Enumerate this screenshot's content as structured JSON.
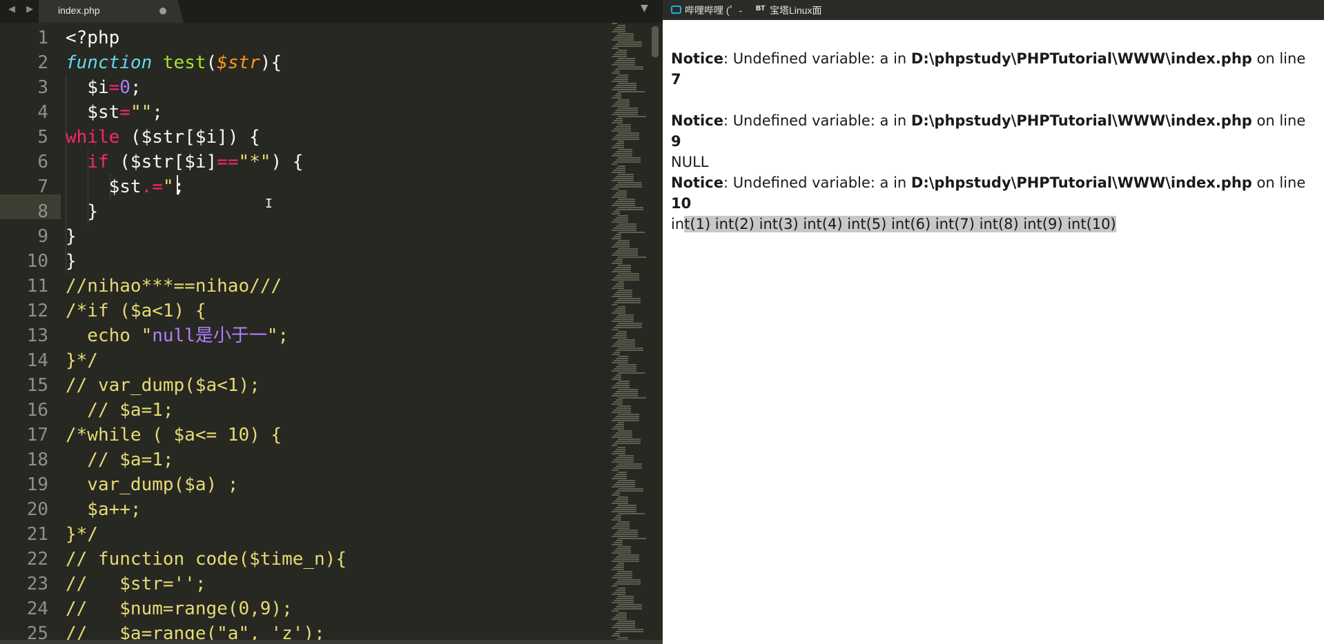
{
  "editor": {
    "nav_arrows": "◀ ▶",
    "tab_title": "index.php",
    "tab_menu_icon": "▼",
    "line_numbers": [
      "1",
      "2",
      "3",
      "4",
      "5",
      "6",
      "7",
      "8",
      "9",
      "10",
      "11",
      "12",
      "13",
      "14",
      "15",
      "16",
      "17",
      "18",
      "19",
      "20",
      "21",
      "22",
      "23",
      "24",
      "25"
    ],
    "lines": [
      {
        "indent": "",
        "tokens": [
          [
            "",
            "<?php"
          ]
        ]
      },
      {
        "indent": "",
        "tokens": [
          [
            "fn",
            "function"
          ],
          [
            "",
            " "
          ],
          [
            "name",
            "test"
          ],
          [
            "",
            "("
          ],
          [
            "param",
            "$str"
          ],
          [
            "",
            "){"
          ]
        ]
      },
      {
        "indent": "  ",
        "tokens": [
          [
            "",
            "$i"
          ],
          [
            "op",
            "="
          ],
          [
            "num",
            "0"
          ],
          [
            "",
            ";"
          ]
        ]
      },
      {
        "indent": "  ",
        "tokens": [
          [
            "",
            "$st"
          ],
          [
            "op",
            "="
          ],
          [
            "str",
            "\"\""
          ],
          [
            "",
            ";"
          ]
        ]
      },
      {
        "indent": "",
        "tokens": [
          [
            "kw",
            "while"
          ],
          [
            "",
            " ($str[$i]) {"
          ]
        ]
      },
      {
        "indent": "  ",
        "tokens": [
          [
            "kw",
            "if"
          ],
          [
            "",
            " ($str[$i]"
          ],
          [
            "op",
            "=="
          ],
          [
            "str",
            "\"*\""
          ],
          [
            "",
            ") {"
          ]
        ]
      },
      {
        "indent": "    ",
        "tokens": [
          [
            "",
            "$st"
          ],
          [
            "op",
            ".="
          ],
          [
            "str",
            "\""
          ],
          [
            "",
            ";"
          ]
        ]
      },
      {
        "indent": "  ",
        "tokens": [
          [
            "",
            "}"
          ]
        ]
      },
      {
        "indent": "",
        "tokens": [
          [
            "",
            "}"
          ]
        ]
      },
      {
        "indent": "",
        "tokens": [
          [
            "",
            "}"
          ]
        ]
      },
      {
        "indent": "",
        "tokens": [
          [
            "com",
            "//nihao***==nihao///"
          ]
        ]
      },
      {
        "indent": "",
        "tokens": [
          [
            "com",
            "/*if ($a<1) {"
          ]
        ]
      },
      {
        "indent": "",
        "tokens": [
          [
            "com",
            "  echo \""
          ],
          [
            "const",
            "null是小于一"
          ],
          [
            "com",
            "\";"
          ]
        ]
      },
      {
        "indent": "",
        "tokens": [
          [
            "com",
            "}*/"
          ]
        ]
      },
      {
        "indent": "",
        "tokens": [
          [
            "com",
            "// var_dump($a<1);"
          ]
        ]
      },
      {
        "indent": "",
        "tokens": [
          [
            "com",
            "  // $a=1;"
          ]
        ]
      },
      {
        "indent": "",
        "tokens": [
          [
            "com",
            "/*while ( $a<= 10) {"
          ]
        ]
      },
      {
        "indent": "",
        "tokens": [
          [
            "com",
            "  // $a=1;"
          ]
        ]
      },
      {
        "indent": "",
        "tokens": [
          [
            "com",
            "  var_dump($a) ;"
          ]
        ]
      },
      {
        "indent": "",
        "tokens": [
          [
            "com",
            "  $a++;"
          ]
        ]
      },
      {
        "indent": "",
        "tokens": [
          [
            "com",
            "}*/"
          ]
        ]
      },
      {
        "indent": "",
        "tokens": [
          [
            "com",
            "// function code($time_n){"
          ]
        ]
      },
      {
        "indent": "",
        "tokens": [
          [
            "com",
            "//   $str='';"
          ]
        ]
      },
      {
        "indent": "",
        "tokens": [
          [
            "com",
            "//   $num=range(0,9);"
          ]
        ]
      },
      {
        "indent": "",
        "tokens": [
          [
            "com",
            "//   $a=range(\"a\", 'z');"
          ]
        ]
      }
    ],
    "colors": {
      "background": "#272822",
      "keyword": "#f92672",
      "function": "#66d9ef",
      "name": "#a6e22e",
      "param": "#fd971f",
      "number": "#ae81ff",
      "string": "#e6db74"
    }
  },
  "browser": {
    "tabs": [
      {
        "label": "哔哩哔哩 (゜-",
        "icon": "bilibili-icon"
      },
      {
        "label": "宝塔Linux面",
        "icon": "bt-icon",
        "icon_text": "BT"
      }
    ],
    "output": [
      {
        "type": "notice",
        "label": "Notice",
        "text": ": Undefined variable: a in ",
        "path": "D:\\phpstudy\\PHPTutorial\\WWW\\index.php",
        "suffix": " on line ",
        "line": "7"
      },
      {
        "type": "notice",
        "label": "Notice",
        "text": ": Undefined variable: a in ",
        "path": "D:\\phpstudy\\PHPTutorial\\WWW\\index.php",
        "suffix": " on line ",
        "line": "9"
      },
      {
        "type": "plain",
        "text": "NULL"
      },
      {
        "type": "notice",
        "label": "Notice",
        "text": ": Undefined variable: a in ",
        "path": "D:\\phpstudy\\PHPTutorial\\WWW\\index.php",
        "suffix": " on line ",
        "line": "10"
      },
      {
        "type": "ints",
        "prefix": "in",
        "selected": "t(1) int(2) int(3) int(4) int(5) int(6) int(7) int(8) int(9) int(10)"
      }
    ]
  }
}
